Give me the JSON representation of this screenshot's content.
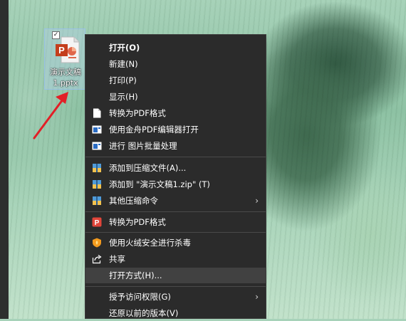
{
  "desktop": {
    "file_icon": {
      "name_line1": "演示文稿",
      "name_line2": "1.pptx",
      "checked_mark": "✓"
    }
  },
  "context_menu": {
    "items": [
      {
        "label": "打开(O)"
      },
      {
        "label": "新建(N)"
      },
      {
        "label": "打印(P)"
      },
      {
        "label": "显示(H)"
      },
      {
        "label": "转换为PDF格式"
      },
      {
        "label": "使用金舟PDF编辑器打开"
      },
      {
        "label": "进行 图片批量处理"
      },
      {
        "label": "添加到压缩文件(A)..."
      },
      {
        "label": "添加到 \"演示文稿1.zip\" (T)"
      },
      {
        "label": "其他压缩命令"
      },
      {
        "label": "转换为PDF格式"
      },
      {
        "label": "使用火绒安全进行杀毒"
      },
      {
        "label": "共享"
      },
      {
        "label": "打开方式(H)..."
      },
      {
        "label": "授予访问权限(G)"
      },
      {
        "label": "还原以前的版本(V)"
      }
    ],
    "submenu_arrow": "›",
    "colors": {
      "menu_bg": "#2b2b2b",
      "hover_bg": "#414141",
      "annotation_arrow": "#e21f26"
    }
  }
}
